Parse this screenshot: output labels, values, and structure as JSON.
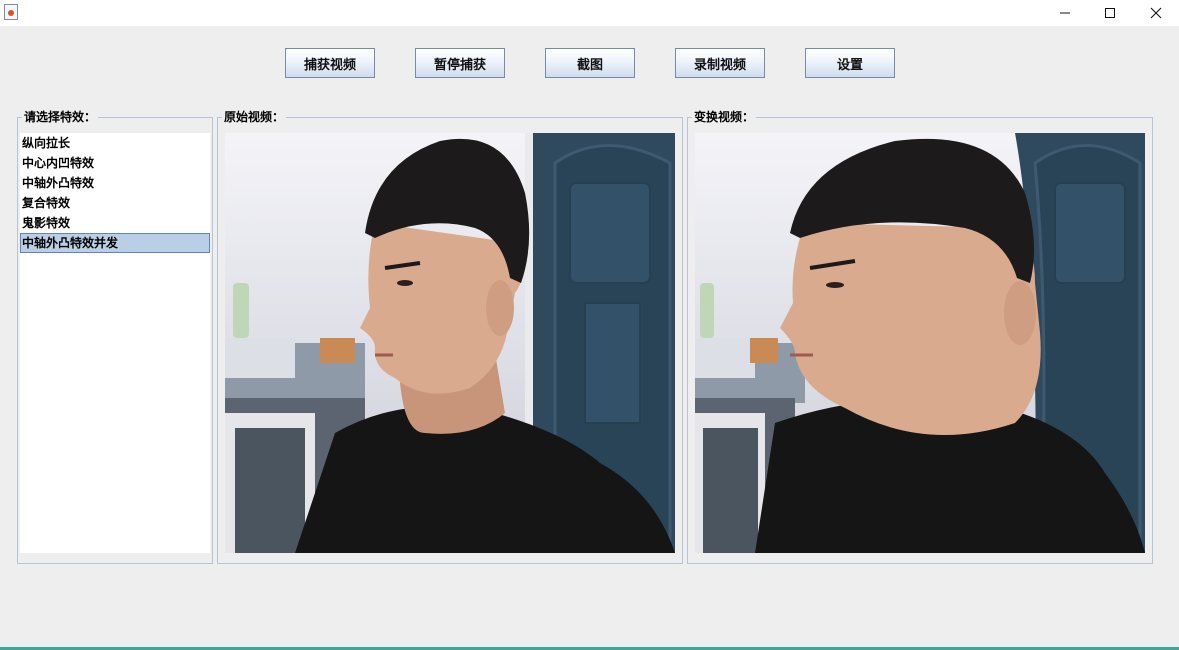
{
  "window": {
    "app_icon": "java-icon",
    "controls": [
      "minimize-icon",
      "maximize-icon",
      "close-icon"
    ]
  },
  "toolbar": {
    "capture_label": "捕获视频",
    "pause_label": "暂停捕获",
    "screenshot_label": "截图",
    "record_label": "录制视频",
    "settings_label": "设置"
  },
  "effects_panel": {
    "title": "请选择特效：",
    "items": [
      {
        "label": "纵向拉长",
        "selected": false
      },
      {
        "label": "中心内凹特效",
        "selected": false
      },
      {
        "label": "中轴外凸特效",
        "selected": false
      },
      {
        "label": "复合特效",
        "selected": false
      },
      {
        "label": "鬼影特效",
        "selected": false
      },
      {
        "label": "中轴外凸特效并发",
        "selected": true
      }
    ]
  },
  "original_panel": {
    "title": "原始视频："
  },
  "transformed_panel": {
    "title": "变换视频："
  },
  "colors": {
    "window_bg": "#eeeeee",
    "selection_bg": "#b8cfe5",
    "selection_border": "#6382bf",
    "door": "#2f4a5e",
    "shirt": "#151515",
    "hair": "#1c1a1a",
    "skin": "#d9aa8e"
  }
}
